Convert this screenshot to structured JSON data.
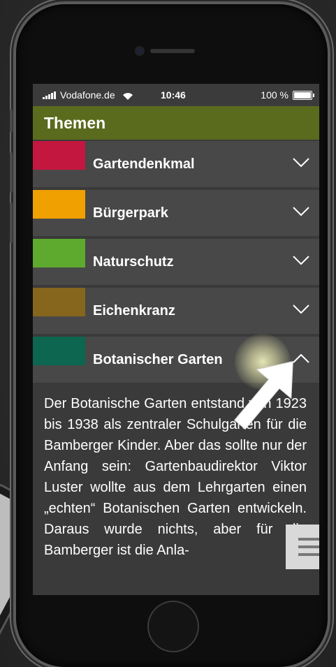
{
  "status_bar": {
    "carrier": "Vodafone.de",
    "time": "10:46",
    "battery": "100 %"
  },
  "header": {
    "title": "Themen"
  },
  "topics": [
    {
      "label": "Gartendenkmal",
      "color": "#c4173f",
      "expanded": false,
      "icon": "chevron-down-icon"
    },
    {
      "label": "Bürgerpark",
      "color": "#f0a000",
      "expanded": false,
      "icon": "chevron-down-icon"
    },
    {
      "label": "Naturschutz",
      "color": "#5daa2e",
      "expanded": false,
      "icon": "chevron-down-icon"
    },
    {
      "label": "Eichenkranz",
      "color": "#86661c",
      "expanded": false,
      "icon": "chevron-down-icon"
    },
    {
      "label": "Botanischer Garten",
      "color": "#0c6650",
      "expanded": true,
      "icon": "chevron-up-icon"
    }
  ],
  "expanded_text": "Der Botanische Garten entstand von 1923 bis 1938 als zentraler Schulgarten für die Bamberger Kinder. Aber das sollte nur der Anfang sein: Gartenbaudirektor Viktor Luster wollte aus dem Lehrgarten einen „echten“ Botanischen Garten entwickeln. Daraus wurde nichts, aber für die Bamberger ist die Anla-",
  "menu_button": {
    "icon": "hamburger-menu-icon"
  },
  "colors": {
    "header_bg": "#5a6b1e",
    "row_bg": "#484848",
    "content_bg": "#3a3a3a"
  }
}
